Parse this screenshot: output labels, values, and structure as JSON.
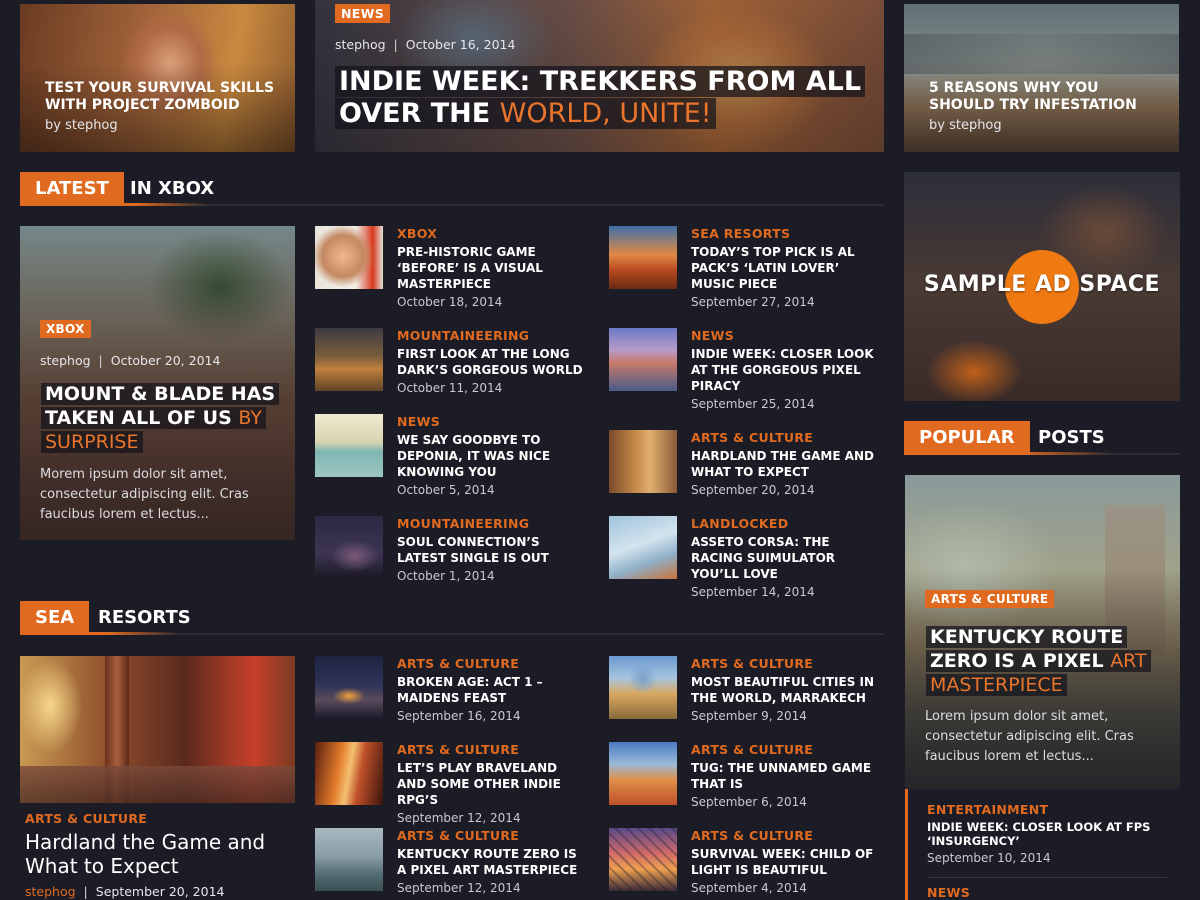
{
  "colors": {
    "accent": "#e06a1f",
    "background": "#1b1c26"
  },
  "top": {
    "left": {
      "title": "TEST YOUR SURVIVAL SKILLS WITH PROJECT ZOMBOID",
      "byline": "by stephog"
    },
    "center": {
      "badge": "NEWS",
      "author": "stephog",
      "date": "October 16, 2014",
      "title_line1": "INDIE WEEK: TREKKERS FROM ALL",
      "title_line2_white": "OVER THE ",
      "title_line2_orange": "WORLD, UNITE!"
    },
    "right": {
      "title": "5 REASONS WHY YOU SHOULD TRY INFESTATION",
      "byline": "by stephog"
    }
  },
  "latest": {
    "tag": "LATEST",
    "rest": "IN XBOX",
    "feature": {
      "badge": "XBOX",
      "author": "stephog",
      "date": "October 20, 2014",
      "title_white": "MOUNT & BLADE HAS TAKEN ALL OF US ",
      "title_orange": "BY SURPRISE",
      "excerpt": "Morem ipsum dolor sit amet, consectetur adipiscing elit. Cras faucibus lorem et lectus..."
    },
    "col1": [
      {
        "category": "XBOX",
        "title": "PRE-HISTORIC GAME ‘BEFORE’ IS A VISUAL MASTERPIECE",
        "date": "October 18, 2014"
      },
      {
        "category": "MOUNTAINEERING",
        "title": "FIRST LOOK AT THE LONG DARK’S GORGEOUS WORLD",
        "date": "October 11, 2014"
      },
      {
        "category": "NEWS",
        "title": "WE SAY GOODBYE TO DEPONIA, IT WAS NICE KNOWING YOU",
        "date": "October 5, 2014"
      },
      {
        "category": "MOUNTAINEERING",
        "title": "SOUL CONNECTION’S LATEST SINGLE IS OUT",
        "date": "October 1, 2014"
      }
    ],
    "col2": [
      {
        "category": "SEA RESORTS",
        "title": "TODAY’S TOP PICK IS AL PACK’S ‘LATIN LOVER’ MUSIC PIECE",
        "date": "September 27, 2014"
      },
      {
        "category": "NEWS",
        "title": "INDIE WEEK: CLOSER LOOK AT THE GORGEOUS PIXEL PIRACY",
        "date": "September 25, 2014"
      },
      {
        "category": "ARTS & CULTURE",
        "title": "HARDLAND THE GAME AND WHAT TO EXPECT",
        "date": "September 20, 2014"
      },
      {
        "category": "LANDLOCKED",
        "title": "ASSETO CORSA: THE RACING SUIMULATOR YOU’LL LOVE",
        "date": "September 14, 2014"
      }
    ]
  },
  "sea": {
    "tag": "SEA",
    "rest": "RESORTS",
    "feature": {
      "category": "ARTS & CULTURE",
      "title": "Hardland the Game and What to Expect",
      "author": "stephog",
      "date": "September 20, 2014"
    },
    "col1": [
      {
        "category": "ARTS & CULTURE",
        "title": "BROKEN AGE: ACT 1 – MAIDENS FEAST",
        "date": "September 16, 2014"
      },
      {
        "category": "ARTS & CULTURE",
        "title": "LET’S PLAY BRAVELAND AND SOME OTHER INDIE RPG’S",
        "date": "September 12, 2014"
      },
      {
        "category": "ARTS & CULTURE",
        "title": "KENTUCKY ROUTE ZERO IS A PIXEL ART MASTERPIECE",
        "date": "September 12, 2014"
      }
    ],
    "col2": [
      {
        "category": "ARTS & CULTURE",
        "title": "MOST BEAUTIFUL CITIES IN THE WORLD, MARRAKECH",
        "date": "September 9, 2014"
      },
      {
        "category": "ARTS & CULTURE",
        "title": "TUG: THE UNNAMED GAME THAT IS",
        "date": "September 6, 2014"
      },
      {
        "category": "ARTS & CULTURE",
        "title": "SURVIVAL WEEK: CHILD OF LIGHT IS BEAUTIFUL",
        "date": "September 4, 2014"
      }
    ]
  },
  "ad": {
    "text": "SAMPLE AD SPACE"
  },
  "popular": {
    "tag": "POPULAR",
    "rest": "POSTS",
    "feature": {
      "badge": "ARTS & CULTURE",
      "title_white": "KENTUCKY ROUTE ZERO IS A PIXEL ",
      "title_orange": "ART MASTERPIECE",
      "excerpt": "Lorem ipsum dolor sit amet, consectetur adipiscing elit. Cras faucibus lorem et lectus..."
    },
    "items": [
      {
        "category": "ENTERTAINMENT",
        "title": "INDIE WEEK: CLOSER LOOK AT FPS ‘INSURGENCY’",
        "date": "September 10, 2014"
      },
      {
        "category": "NEWS"
      }
    ]
  }
}
